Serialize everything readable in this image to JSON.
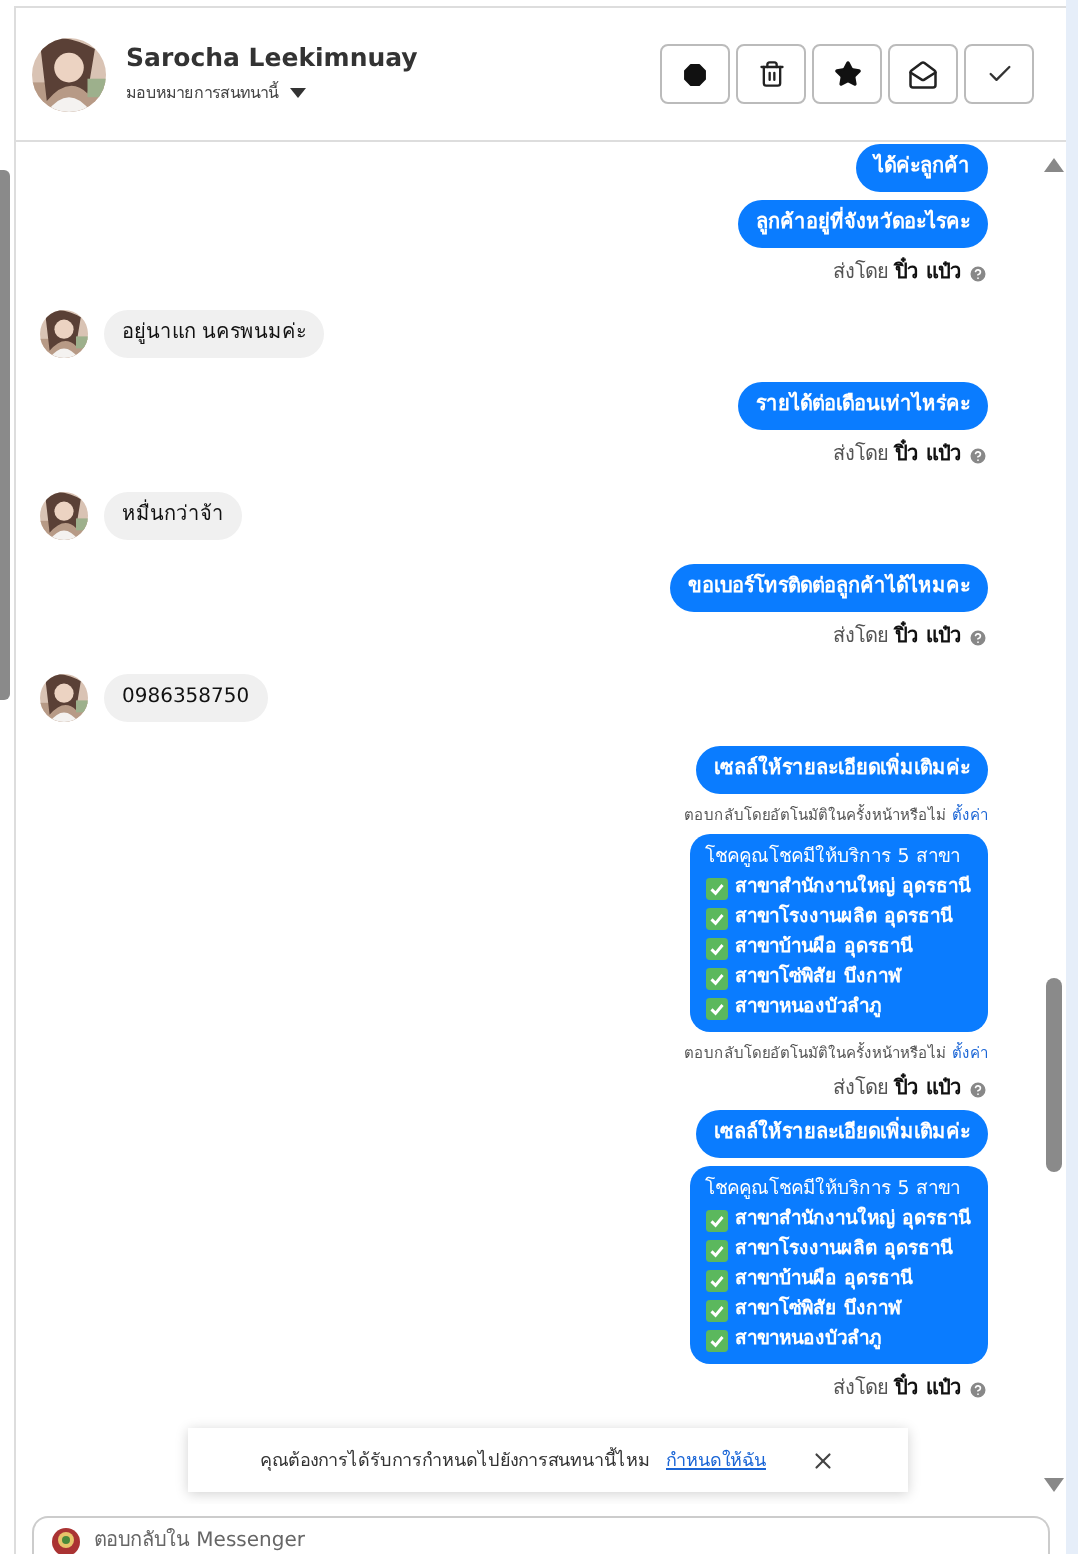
{
  "header": {
    "name": "Sarocha Leekimnuay",
    "assign_label": "มอบหมายการสนทนานี้"
  },
  "messages": [
    {
      "kind": "outgoing",
      "text": "ได้ค่ะลูกค้า"
    },
    {
      "kind": "outgoing",
      "text": "ลูกค้าอยู่ที่จังหวัดอะไรคะ"
    },
    {
      "kind": "sent_by",
      "label": "ส่งโดย",
      "sender": "ปิ๋ว แป๋ว"
    },
    {
      "kind": "incoming",
      "text": "อยู่นาแก นครพนมค่ะ"
    },
    {
      "kind": "outgoing",
      "text": "รายได้ต่อเดือนเท่าไหร่คะ"
    },
    {
      "kind": "sent_by",
      "label": "ส่งโดย",
      "sender": "ปิ๋ว แป๋ว"
    },
    {
      "kind": "incoming",
      "text": "หมื่นกว่าจ้า"
    },
    {
      "kind": "outgoing",
      "text": "ขอเบอร์โทรติดต่อลูกค้าได้ไหมคะ"
    },
    {
      "kind": "sent_by",
      "label": "ส่งโดย",
      "sender": "ปิ๋ว แป๋ว"
    },
    {
      "kind": "incoming",
      "text": "0986358750"
    },
    {
      "kind": "outgoing",
      "text": "เซลล์ให้รายละเอียดเพิ่มเติมค่ะ"
    },
    {
      "kind": "auto_note",
      "text": "ตอบกลับโดยอัตโนมัติในครั้งหน้าหรือไม่",
      "link": "ตั้งค่า"
    },
    {
      "kind": "list",
      "title": "โชคคูณโชคมีให้บริการ 5 สาขา",
      "items": [
        "สาขาสำนักงานใหญ่ อุดรธานี",
        "สาขาโรงงานผลิต อุดรธานี",
        "สาขาบ้านผือ อุดรธานี",
        "สาขาโซ่พิสัย บึงกาฬ",
        "สาขาหนองบัวลำภู"
      ]
    },
    {
      "kind": "auto_note",
      "text": "ตอบกลับโดยอัตโนมัติในครั้งหน้าหรือไม่",
      "link": "ตั้งค่า"
    },
    {
      "kind": "sent_by",
      "label": "ส่งโดย",
      "sender": "ปิ๋ว แป๋ว"
    },
    {
      "kind": "outgoing",
      "text": "เซลล์ให้รายละเอียดเพิ่มเติมค่ะ"
    },
    {
      "kind": "list",
      "title": "โชคคูณโชคมีให้บริการ 5 สาขา",
      "items": [
        "สาขาสำนักงานใหญ่ อุดรธานี",
        "สาขาโรงงานผลิต อุดรธานี",
        "สาขาบ้านผือ อุดรธานี",
        "สาขาโซ่พิสัย บึงกาฬ",
        "สาขาหนองบัวลำภู"
      ]
    },
    {
      "kind": "sent_by",
      "label": "ส่งโดย",
      "sender": "ปิ๋ว แป๋ว"
    }
  ],
  "toast": {
    "text": "คุณต้องการได้รับการกำหนดไปยังการสนทนานี้ไหม",
    "link": "กำหนดให้ฉัน"
  },
  "composer": {
    "placeholder": "ตอบกลับใน Messenger"
  }
}
